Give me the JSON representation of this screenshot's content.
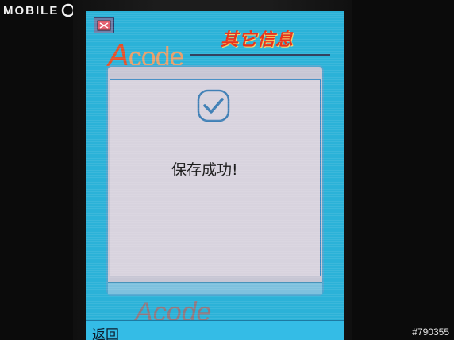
{
  "watermark": {
    "logo_text": "MOBILE",
    "image_id": "#790355"
  },
  "header": {
    "title": "其它信息",
    "brand_text_a": "A",
    "brand_text_rest": "code"
  },
  "dialog": {
    "message": "保存成功!",
    "icon": "checkmark-icon"
  },
  "softkeys": {
    "left_label": "返回"
  },
  "colors": {
    "screen_bg": "#2bb2d8",
    "title": "#e8321a",
    "panel": "#c7c6d4",
    "content": "#d8d3de"
  }
}
